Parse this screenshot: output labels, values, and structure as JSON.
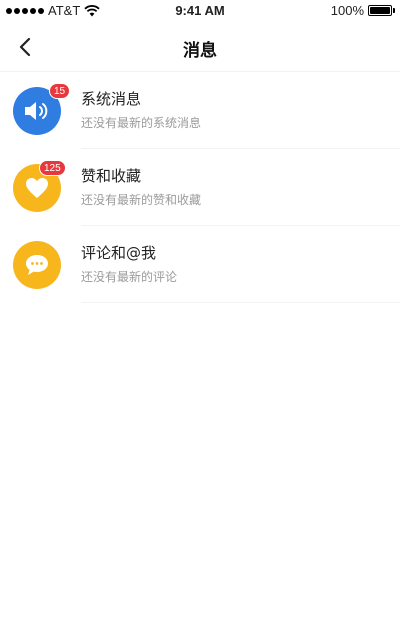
{
  "status_bar": {
    "carrier": "AT&T",
    "time": "9:41 AM",
    "battery": "100%"
  },
  "nav": {
    "title": "消息"
  },
  "messages": [
    {
      "title": "系统消息",
      "subtitle": "还没有最新的系统消息",
      "badge": "15",
      "icon": "speaker-icon",
      "color": "#2f7de1"
    },
    {
      "title": "赞和收藏",
      "subtitle": "还没有最新的赞和收藏",
      "badge": "125",
      "icon": "heart-icon",
      "color": "#f7b71c"
    },
    {
      "title": "评论和@我",
      "subtitle": "还没有最新的评论",
      "badge": "",
      "icon": "chat-bubble-icon",
      "color": "#f7b71c"
    }
  ]
}
